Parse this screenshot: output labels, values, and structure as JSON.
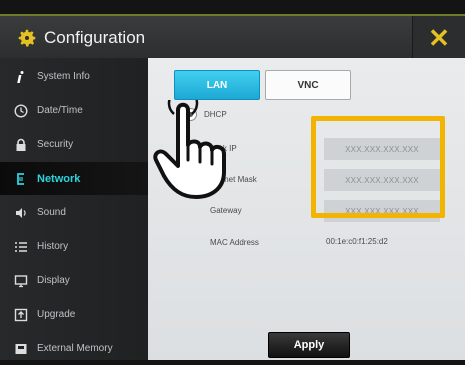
{
  "window": {
    "title": "Configuration",
    "close_label": "✕",
    "accent_color": "#e5c221"
  },
  "sidebar": {
    "items": [
      {
        "label": "System Info",
        "icon": "info-icon"
      },
      {
        "label": "Date/Time",
        "icon": "clock-icon"
      },
      {
        "label": "Security",
        "icon": "lock-icon"
      },
      {
        "label": "Network",
        "icon": "network-icon",
        "active": true
      },
      {
        "label": "Sound",
        "icon": "speaker-icon"
      },
      {
        "label": "History",
        "icon": "list-icon"
      },
      {
        "label": "Display",
        "icon": "monitor-icon"
      },
      {
        "label": "Upgrade",
        "icon": "upgrade-icon"
      },
      {
        "label": "External Memory",
        "icon": "memory-icon"
      }
    ],
    "active_color": "#2ed3df"
  },
  "tabs": [
    {
      "label": "LAN",
      "active": true
    },
    {
      "label": "VNC",
      "active": false
    }
  ],
  "form": {
    "dhcp_label": "DHCP",
    "ip_label": "Lock IP",
    "subnet_label": "Subnet Mask",
    "gateway_label": "Gateway",
    "mac_label": "MAC Address",
    "ip_value": "XXX.XXX.XXX.XXX",
    "subnet_value": "XXX.XXX.XXX.XXX",
    "gateway_value": "XXX.XXX.XXX.XXX",
    "mac_value": "00:1e:c0:f1:25:d2"
  },
  "apply_label": "Apply",
  "highlight_color": "#f2b400"
}
